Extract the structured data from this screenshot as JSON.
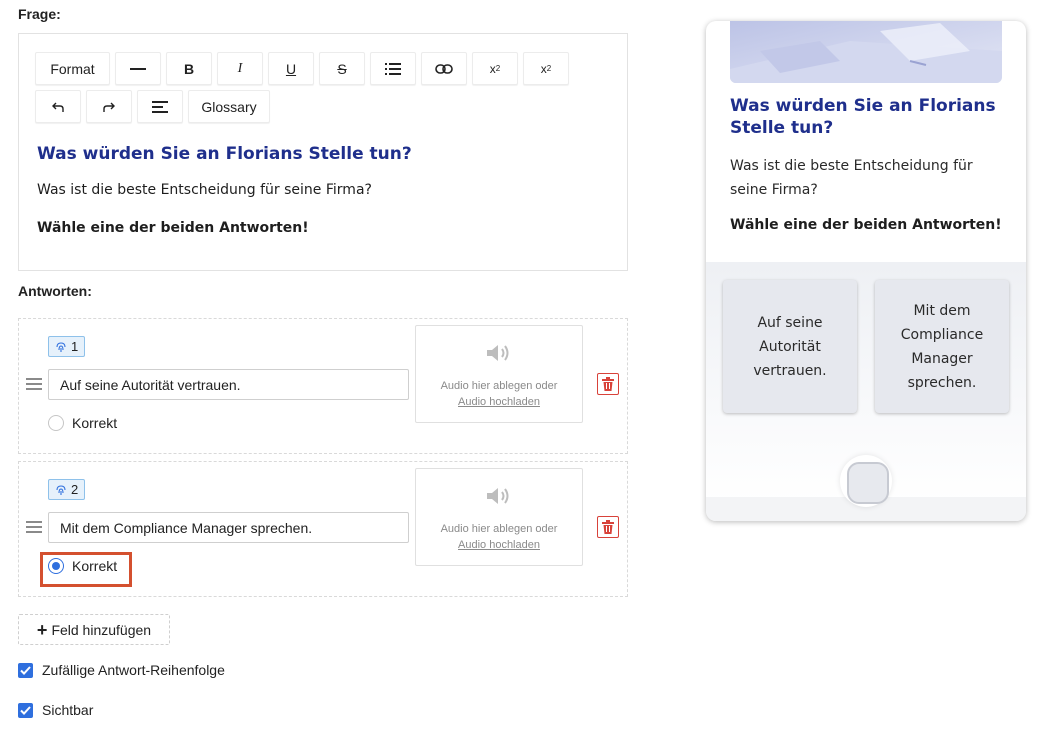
{
  "labels": {
    "question": "Frage:",
    "answers": "Antworten:"
  },
  "toolbar": {
    "format": "Format",
    "bold": "B",
    "italic": "I",
    "underline": "U",
    "strike": "S",
    "sup_base": "x",
    "sup": "2",
    "sub_base": "x",
    "sub": "2",
    "glossary": "Glossary"
  },
  "editor": {
    "heading": "Was würden Sie an Florians Stelle tun?",
    "paragraph": "Was ist die beste Entscheidung für seine Firma?",
    "bold_line": "Wähle eine der beiden Antworten!"
  },
  "answers": [
    {
      "number": "1",
      "text": "Auf seine Autorität vertrauen.",
      "correct_label": "Korrekt",
      "correct": false
    },
    {
      "number": "2",
      "text": "Mit dem Compliance Manager sprechen.",
      "correct_label": "Korrekt",
      "correct": true
    }
  ],
  "audio": {
    "drop_text": "Audio hier ablegen oder",
    "upload_link": "Audio hochladen"
  },
  "add_field": "Feld hinzufügen",
  "options": {
    "random_order": "Zufällige Antwort-Reihenfolge",
    "visible": "Sichtbar"
  },
  "preview": {
    "title": "Was würden Sie an Florians Stelle tun?",
    "text": "Was ist die beste Entscheidung für seine Firma?",
    "bold": "Wähle eine der beiden Antworten!",
    "answers": [
      "Auf seine Autorität vertrauen.",
      "Mit dem Compliance Manager sprechen."
    ]
  },
  "colors": {
    "accent_blue": "#2f6fde",
    "heading_navy": "#1f2f8c",
    "highlight": "#d4502f",
    "danger": "#d8423a"
  }
}
